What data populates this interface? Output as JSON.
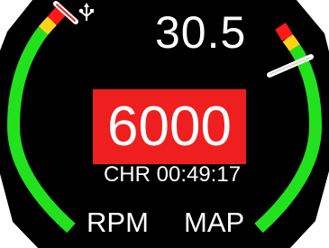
{
  "top_value": "30.5",
  "main_value": "6000",
  "chrono": "CHR 00:49:17",
  "labels": {
    "left": "RPM",
    "right": "MAP"
  },
  "status_icon": "usb-icon",
  "left_gauge": {
    "level": 0.9,
    "colors": {
      "normal": "#22e21d",
      "caution": "#ffd21a",
      "danger": "#ff1a1a"
    }
  },
  "right_gauge": {
    "level": 0.82,
    "colors": {
      "normal": "#22e21d",
      "caution": "#ffd21a",
      "danger": "#ff1a1a"
    }
  }
}
